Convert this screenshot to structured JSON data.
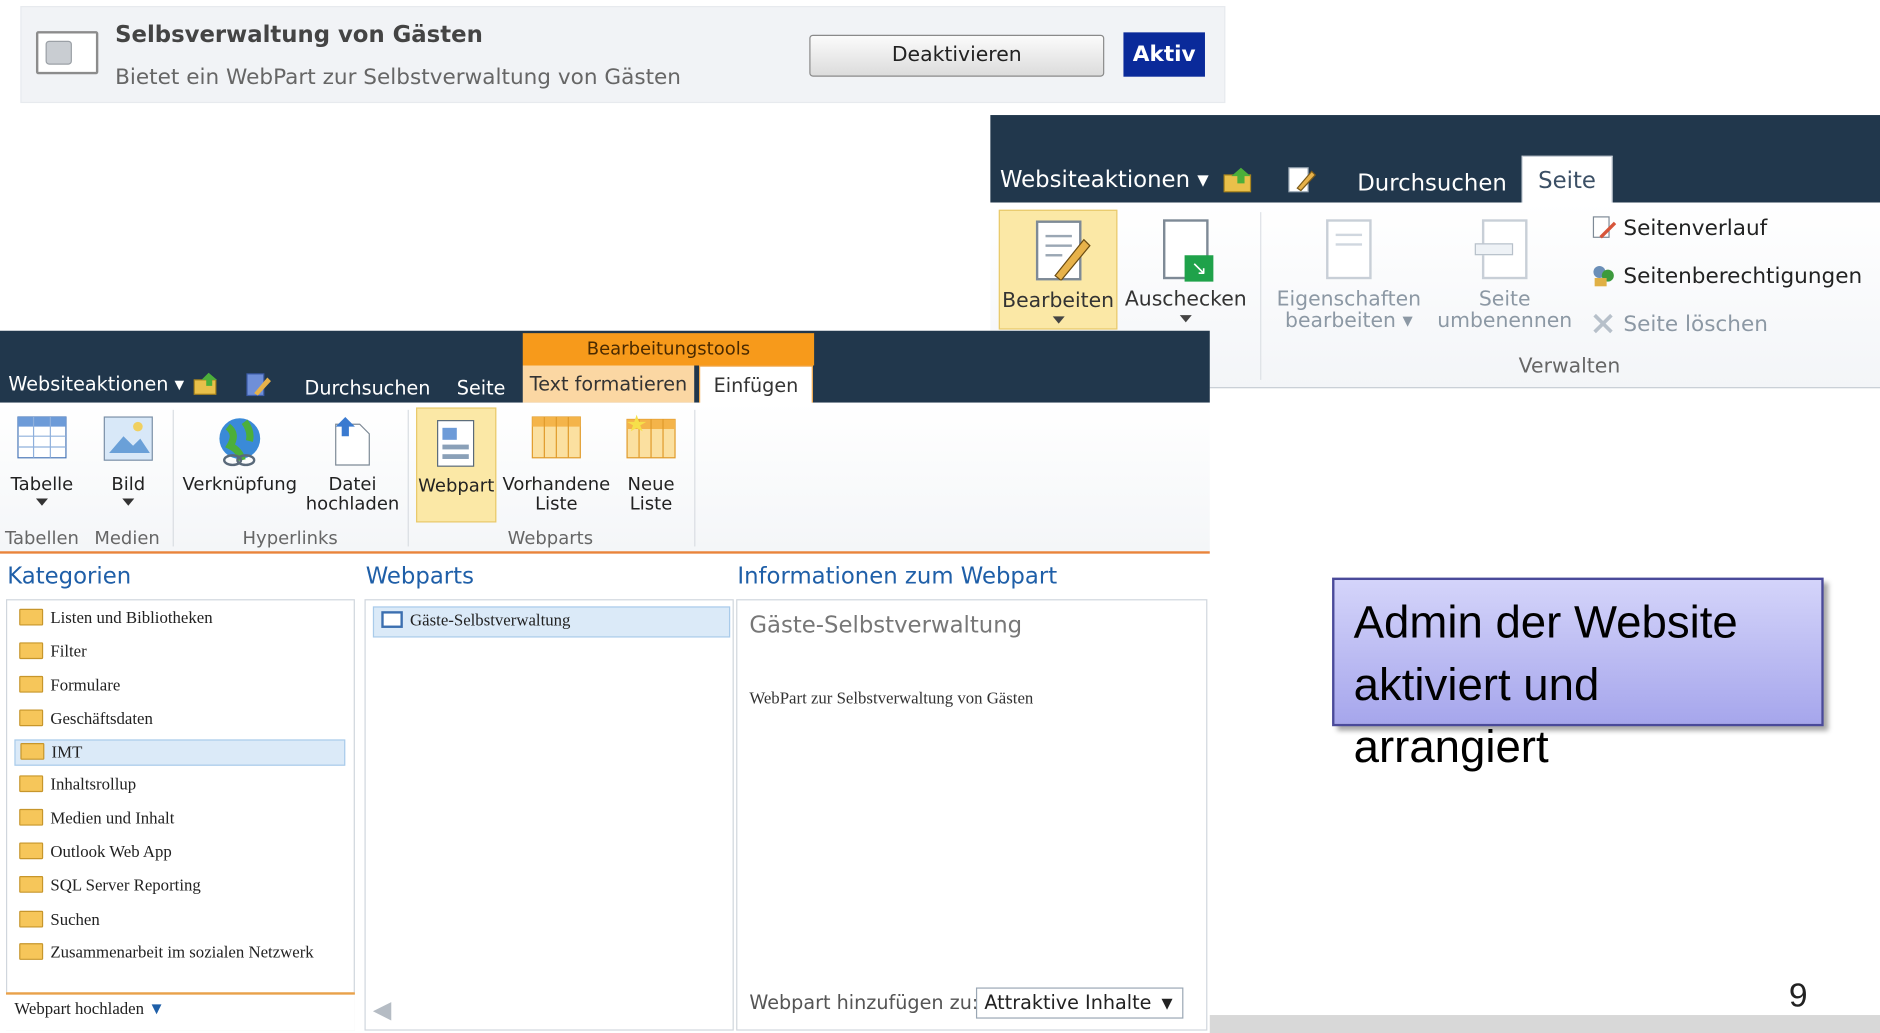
{
  "feature": {
    "title": "Selbsverwaltung von Gästen",
    "description": "Bietet ein WebPart zur Selbstverwaltung von Gästen",
    "deactivate_label": "Deaktivieren",
    "status": "Aktiv"
  },
  "ribbon_page": {
    "site_actions": "Websiteaktionen",
    "tabs": [
      "Durchsuchen",
      "Seite"
    ],
    "buttons": {
      "edit": "Bearbeiten",
      "checkout": "Auschecken",
      "properties_1": "Eigenschaften",
      "properties_2": "bearbeiten",
      "rename_1": "Seite",
      "rename_2": "umbenennen"
    },
    "small_items": [
      "Seitenverlauf",
      "Seitenberechtigungen",
      "Seite löschen"
    ],
    "group": "Verwalten"
  },
  "ribbon_insert": {
    "site_actions": "Websiteaktionen",
    "tabs": [
      "Durchsuchen",
      "Seite",
      "Text formatieren",
      "Einfügen"
    ],
    "context_header": "Bearbeitungstools",
    "buttons": {
      "table": "Tabelle",
      "image": "Bild",
      "link": "Verknüpfung",
      "upload_1": "Datei",
      "upload_2": "hochladen",
      "webpart": "Webpart",
      "existing_1": "Vorhandene",
      "existing_2": "Liste",
      "new_1": "Neue",
      "new_2": "Liste"
    },
    "groups": [
      "Tabellen",
      "Medien",
      "Hyperlinks",
      "Webparts"
    ]
  },
  "picker": {
    "categories_header": "Kategorien",
    "webparts_header": "Webparts",
    "info_header": "Informationen zum Webpart",
    "categories": [
      "Listen und Bibliotheken",
      "Filter",
      "Formulare",
      "Geschäftsdaten",
      "IMT",
      "Inhaltsrollup",
      "Medien und Inhalt",
      "Outlook Web App",
      "SQL Server Reporting",
      "Suchen",
      "Zusammenarbeit im sozialen Netzwerk"
    ],
    "selected_category": "IMT",
    "upload_link": "Webpart hochladen",
    "webpart_item": "Gäste-Selbstverwaltung",
    "info_title": "Gäste-Selbstverwaltung",
    "info_desc": "WebPart zur Selbstverwaltung von Gästen",
    "add_to_label": "Webpart hinzufügen zu:",
    "add_to_value": "Attraktive Inhalte"
  },
  "callout": {
    "line1": "Admin der Website",
    "line2": "aktiviert und arrangiert"
  },
  "page_number": "9"
}
